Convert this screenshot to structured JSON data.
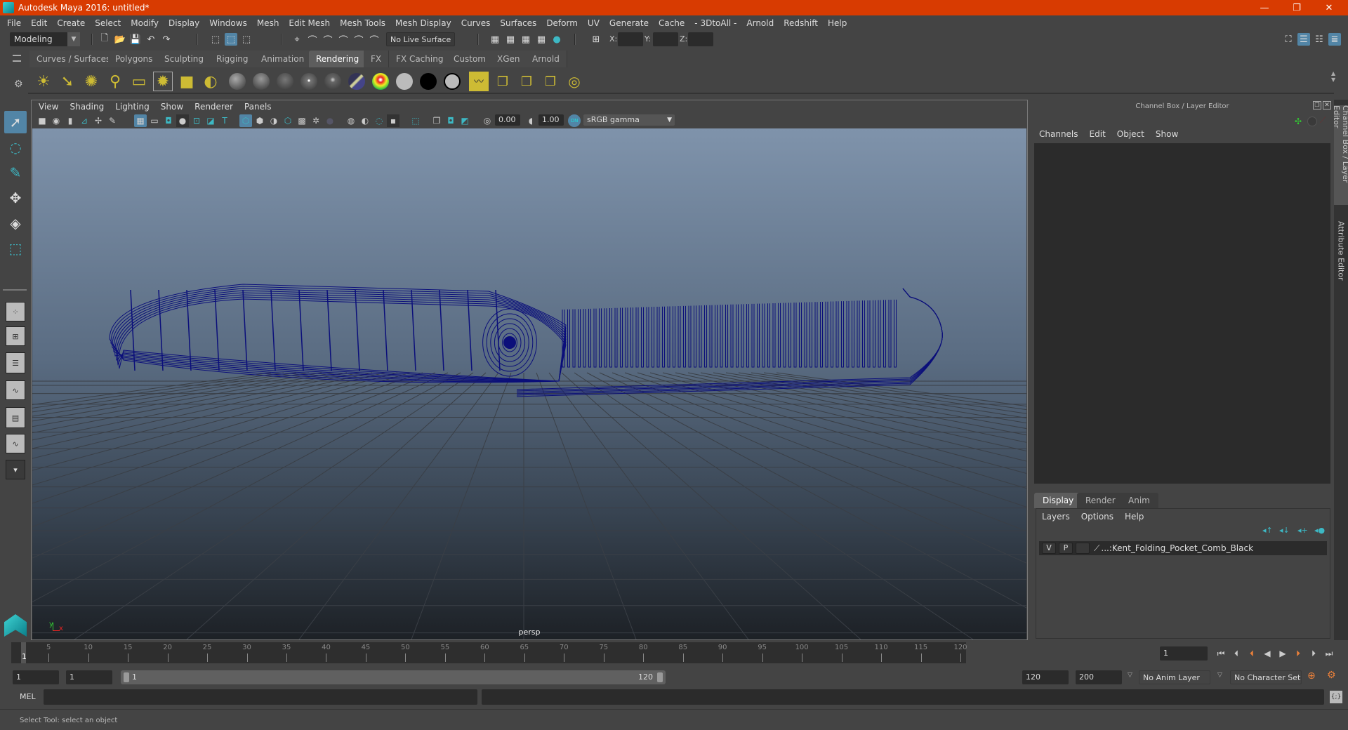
{
  "window": {
    "title": "Autodesk Maya 2016: untitled*",
    "controls": {
      "minimize": "—",
      "maximize": "❐",
      "close": "✕"
    },
    "title_bar_color": "#d83b01"
  },
  "menubar": [
    "File",
    "Edit",
    "Create",
    "Select",
    "Modify",
    "Display",
    "Windows",
    "Mesh",
    "Edit Mesh",
    "Mesh Tools",
    "Mesh Display",
    "Curves",
    "Surfaces",
    "Deform",
    "UV",
    "Generate",
    "Cache",
    "- 3DtoAll -",
    "Arnold",
    "Redshift",
    "Help"
  ],
  "status_line": {
    "mode": "Modeling",
    "live_surface": "No Live Surface",
    "x_label": "X:",
    "y_label": "Y:",
    "z_label": "Z:",
    "x_value": "",
    "y_value": "",
    "z_value": ""
  },
  "shelf": {
    "tabs": [
      "Curves / Surfaces",
      "Polygons",
      "Sculpting",
      "Rigging",
      "Animation",
      "Rendering",
      "FX",
      "FX Caching",
      "Custom",
      "XGen",
      "Arnold"
    ],
    "active_tab": "Rendering",
    "icons": [
      "ambient-light",
      "directional-light",
      "point-light",
      "spot-light",
      "area-light",
      "volume-light",
      "camera-aim",
      "light-editor",
      "blinn-sphere",
      "lambert-sphere",
      "phong-sphere",
      "phonge-sphere",
      "anisotropic-sphere",
      "layered-shader",
      "ramp-shader",
      "surface-shader-white",
      "surface-shader-black",
      "use-background",
      "hypershade",
      "render-view",
      "render-settings",
      "render-options",
      "ipr-render"
    ]
  },
  "toolbox": {
    "tools": [
      "select-tool",
      "lasso-tool",
      "paint-select-tool",
      "move-tool",
      "rotate-tool",
      "scale-tool"
    ],
    "active": "select-tool",
    "layouts": [
      "single-perspective",
      "four-view",
      "persp-outliner",
      "persp-graph",
      "hypershade-persp",
      "persp-graph-outliner",
      "more-layouts"
    ]
  },
  "viewport": {
    "menu": [
      "View",
      "Shading",
      "Lighting",
      "Show",
      "Renderer",
      "Panels"
    ],
    "exposure": "0.00",
    "gamma": "1.00",
    "color_mgmt_badge": "ON",
    "view_transform": "sRGB gamma",
    "camera_label": "persp",
    "axis": {
      "y": "y",
      "x": "x"
    },
    "wireframe_color": "#0b0f7a",
    "background_top": "#7f93ab",
    "background_bottom": "#1d2126"
  },
  "channel_box": {
    "title": "Channel Box / Layer Editor",
    "menu": [
      "Channels",
      "Edit",
      "Object",
      "Show"
    ]
  },
  "layer_editor": {
    "tabs": [
      "Display",
      "Render",
      "Anim"
    ],
    "active_tab": "Display",
    "menu": [
      "Layers",
      "Options",
      "Help"
    ],
    "layers": [
      {
        "visible": "V",
        "playback": "P",
        "name": "...:Kent_Folding_Pocket_Comb_Black"
      }
    ]
  },
  "side_tabs": [
    "Channel Box / Layer Editor",
    "Attribute Editor"
  ],
  "timeline": {
    "ticks": [
      5,
      10,
      15,
      20,
      25,
      30,
      35,
      40,
      45,
      50,
      55,
      60,
      65,
      70,
      75,
      80,
      85,
      90,
      95,
      100,
      105,
      110,
      115,
      120
    ],
    "start": 1,
    "end": 120,
    "current_frame": "1",
    "current_frame_marker": "1"
  },
  "range": {
    "start_time": "1",
    "playback_start": "1",
    "range_start_label": "1",
    "range_end_label": "120",
    "playback_end": "120",
    "end_time": "200",
    "anim_layer": "No Anim Layer",
    "character_set": "No Character Set"
  },
  "command_line": {
    "label": "MEL",
    "value": "",
    "result": ""
  },
  "help_line": {
    "text": "Select Tool: select an object"
  }
}
